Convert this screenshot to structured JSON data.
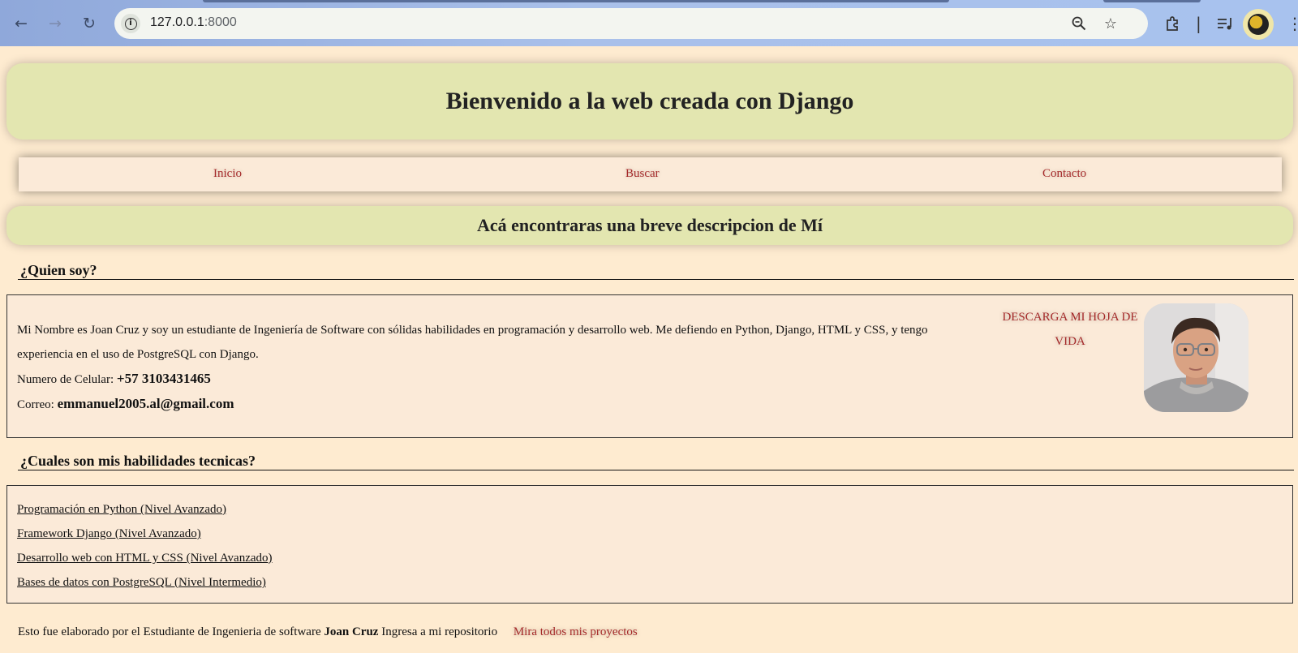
{
  "browser": {
    "url_host": "127.0.0.1",
    "url_port": ":8000"
  },
  "header": {
    "title": "Bienvenido a la web creada con Django"
  },
  "nav": {
    "items": [
      {
        "label": "Inicio"
      },
      {
        "label": "Buscar"
      },
      {
        "label": "Contacto"
      }
    ]
  },
  "subheader": {
    "title": "Acá encontraras una breve descripcion de Mí"
  },
  "about": {
    "heading": "¿Quien soy?",
    "description": "Mi Nombre es Joan Cruz y soy un estudiante de Ingeniería de Software con sólidas habilidades en programación y desarrollo web. Me defiendo en Python, Django, HTML y CSS, y tengo experiencia en el uso de PostgreSQL con Django.",
    "phone_label": "Numero de Celular:",
    "phone_value": "+57 3103431465",
    "email_label": "Correo:",
    "email_value": "emmanuel2005.al@gmail.com",
    "cv_link": "DESCARGA MI HOJA DE VIDA"
  },
  "skills": {
    "heading": "¿Cuales son mis habilidades tecnicas?",
    "items": [
      "Programación en Python (Nivel Avanzado)",
      "Framework Django (Nivel Avanzado)",
      "Desarrollo web con HTML y CSS (Nivel Avanzado)",
      "Bases de datos con PostgreSQL (Nivel Intermedio)"
    ]
  },
  "footer": {
    "text": "Esto fue elaborado por el Estudiante de Ingenieria de software",
    "author": "Joan Cruz",
    "repo_text": "Ingresa a mi repositorio",
    "projects_link": "Mira todos mis proyectos"
  },
  "colors": {
    "page_bg": "#feebd0",
    "header_bg": "#e3e6b0",
    "link": "#a52a2a",
    "panel_bg": "#fbead8"
  }
}
